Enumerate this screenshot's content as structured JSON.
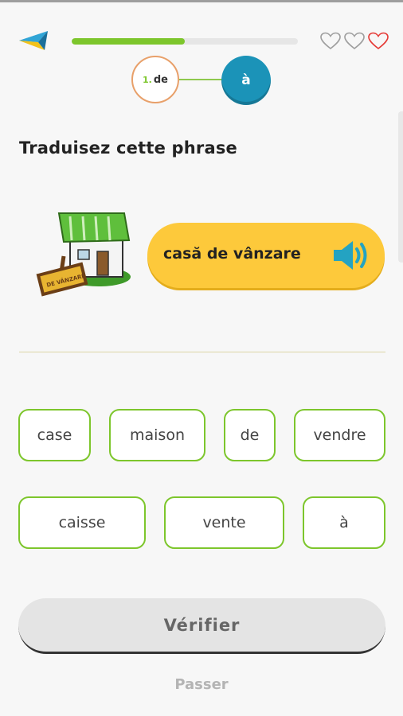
{
  "header": {
    "progress_percent": 50,
    "lives_total": 3,
    "lives_remaining": 1
  },
  "steps": [
    {
      "number": "1.",
      "label": "de"
    },
    {
      "label": "à"
    }
  ],
  "exercise": {
    "instruction": "Traduisez cette phrase",
    "source_phrase": "casă de vânzare",
    "sign_text": "DE VÂNZARE"
  },
  "word_bank": [
    "case",
    "maison",
    "de",
    "vendre",
    "caisse",
    "vente",
    "à"
  ],
  "buttons": {
    "verify": "Vérifier",
    "skip": "Passer"
  },
  "colors": {
    "accent_green": "#7dc62c",
    "phrase_bg": "#fdc93b",
    "step_blue": "#1b93b8",
    "heart_red": "#e53935"
  }
}
